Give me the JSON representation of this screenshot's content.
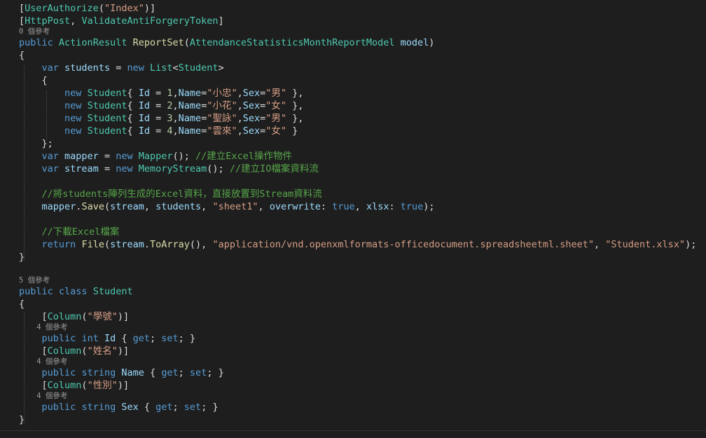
{
  "editor": {
    "colors": {
      "background": "#1e1e1e",
      "keyword": "#569cd6",
      "type": "#4ec9b0",
      "method": "#dcdcaa",
      "string": "#d69d85",
      "number": "#b5cea8",
      "comment": "#57a64a",
      "plain": "#dcdcdc",
      "variable": "#9cdcfe",
      "lens": "#999999"
    },
    "lines": [
      {
        "kind": "code",
        "tokens": [
          {
            "t": "[",
            "c": "plain"
          },
          {
            "t": "UserAuthorize",
            "c": "type"
          },
          {
            "t": "(",
            "c": "plain"
          },
          {
            "t": "\"Index\"",
            "c": "string"
          },
          {
            "t": ")]",
            "c": "plain"
          }
        ]
      },
      {
        "kind": "code",
        "tokens": [
          {
            "t": "[",
            "c": "plain"
          },
          {
            "t": "HttpPost",
            "c": "type"
          },
          {
            "t": ", ",
            "c": "plain"
          },
          {
            "t": "ValidateAntiForgeryToken",
            "c": "type"
          },
          {
            "t": "]",
            "c": "plain"
          }
        ]
      },
      {
        "kind": "lens",
        "text": "0 個參考"
      },
      {
        "kind": "code",
        "tokens": [
          {
            "t": "public",
            "c": "keyword"
          },
          {
            "t": " ",
            "c": "plain"
          },
          {
            "t": "ActionResult",
            "c": "type"
          },
          {
            "t": " ",
            "c": "plain"
          },
          {
            "t": "ReportSet",
            "c": "method"
          },
          {
            "t": "(",
            "c": "plain"
          },
          {
            "t": "AttendanceStatisticsMonthReportModel",
            "c": "type"
          },
          {
            "t": " ",
            "c": "plain"
          },
          {
            "t": "model",
            "c": "variable"
          },
          {
            "t": ")",
            "c": "plain"
          }
        ]
      },
      {
        "kind": "code",
        "tokens": [
          {
            "t": "{",
            "c": "plain"
          }
        ]
      },
      {
        "kind": "code",
        "tokens": [
          {
            "t": "    ",
            "c": "plain"
          },
          {
            "t": "var",
            "c": "keyword"
          },
          {
            "t": " ",
            "c": "plain"
          },
          {
            "t": "students",
            "c": "variable"
          },
          {
            "t": " = ",
            "c": "plain"
          },
          {
            "t": "new",
            "c": "keyword"
          },
          {
            "t": " ",
            "c": "plain"
          },
          {
            "t": "List",
            "c": "type"
          },
          {
            "t": "<",
            "c": "plain"
          },
          {
            "t": "Student",
            "c": "type"
          },
          {
            "t": ">",
            "c": "plain"
          }
        ]
      },
      {
        "kind": "code",
        "tokens": [
          {
            "t": "    {",
            "c": "plain"
          }
        ]
      },
      {
        "kind": "code",
        "tokens": [
          {
            "t": "        ",
            "c": "plain"
          },
          {
            "t": "new",
            "c": "keyword"
          },
          {
            "t": " ",
            "c": "plain"
          },
          {
            "t": "Student",
            "c": "type"
          },
          {
            "t": "{ ",
            "c": "plain"
          },
          {
            "t": "Id",
            "c": "variable"
          },
          {
            "t": " = ",
            "c": "plain"
          },
          {
            "t": "1",
            "c": "number"
          },
          {
            "t": ",",
            "c": "plain"
          },
          {
            "t": "Name",
            "c": "variable"
          },
          {
            "t": "=",
            "c": "plain"
          },
          {
            "t": "\"小忠\"",
            "c": "string"
          },
          {
            "t": ",",
            "c": "plain"
          },
          {
            "t": "Sex",
            "c": "variable"
          },
          {
            "t": "=",
            "c": "plain"
          },
          {
            "t": "\"男\"",
            "c": "string"
          },
          {
            "t": " },",
            "c": "plain"
          }
        ]
      },
      {
        "kind": "code",
        "tokens": [
          {
            "t": "        ",
            "c": "plain"
          },
          {
            "t": "new",
            "c": "keyword"
          },
          {
            "t": " ",
            "c": "plain"
          },
          {
            "t": "Student",
            "c": "type"
          },
          {
            "t": "{ ",
            "c": "plain"
          },
          {
            "t": "Id",
            "c": "variable"
          },
          {
            "t": " = ",
            "c": "plain"
          },
          {
            "t": "2",
            "c": "number"
          },
          {
            "t": ",",
            "c": "plain"
          },
          {
            "t": "Name",
            "c": "variable"
          },
          {
            "t": "=",
            "c": "plain"
          },
          {
            "t": "\"小花\"",
            "c": "string"
          },
          {
            "t": ",",
            "c": "plain"
          },
          {
            "t": "Sex",
            "c": "variable"
          },
          {
            "t": "=",
            "c": "plain"
          },
          {
            "t": "\"女\"",
            "c": "string"
          },
          {
            "t": " },",
            "c": "plain"
          }
        ]
      },
      {
        "kind": "code",
        "tokens": [
          {
            "t": "        ",
            "c": "plain"
          },
          {
            "t": "new",
            "c": "keyword"
          },
          {
            "t": " ",
            "c": "plain"
          },
          {
            "t": "Student",
            "c": "type"
          },
          {
            "t": "{ ",
            "c": "plain"
          },
          {
            "t": "Id",
            "c": "variable"
          },
          {
            "t": " = ",
            "c": "plain"
          },
          {
            "t": "3",
            "c": "number"
          },
          {
            "t": ",",
            "c": "plain"
          },
          {
            "t": "Name",
            "c": "variable"
          },
          {
            "t": "=",
            "c": "plain"
          },
          {
            "t": "\"聖詠\"",
            "c": "string"
          },
          {
            "t": ",",
            "c": "plain"
          },
          {
            "t": "Sex",
            "c": "variable"
          },
          {
            "t": "=",
            "c": "plain"
          },
          {
            "t": "\"男\"",
            "c": "string"
          },
          {
            "t": " },",
            "c": "plain"
          }
        ]
      },
      {
        "kind": "code",
        "tokens": [
          {
            "t": "        ",
            "c": "plain"
          },
          {
            "t": "new",
            "c": "keyword"
          },
          {
            "t": " ",
            "c": "plain"
          },
          {
            "t": "Student",
            "c": "type"
          },
          {
            "t": "{ ",
            "c": "plain"
          },
          {
            "t": "Id",
            "c": "variable"
          },
          {
            "t": " = ",
            "c": "plain"
          },
          {
            "t": "4",
            "c": "number"
          },
          {
            "t": ",",
            "c": "plain"
          },
          {
            "t": "Name",
            "c": "variable"
          },
          {
            "t": "=",
            "c": "plain"
          },
          {
            "t": "\"雲來\"",
            "c": "string"
          },
          {
            "t": ",",
            "c": "plain"
          },
          {
            "t": "Sex",
            "c": "variable"
          },
          {
            "t": "=",
            "c": "plain"
          },
          {
            "t": "\"女\"",
            "c": "string"
          },
          {
            "t": " }",
            "c": "plain"
          }
        ]
      },
      {
        "kind": "code",
        "tokens": [
          {
            "t": "    };",
            "c": "plain"
          }
        ]
      },
      {
        "kind": "code",
        "tokens": [
          {
            "t": "    ",
            "c": "plain"
          },
          {
            "t": "var",
            "c": "keyword"
          },
          {
            "t": " ",
            "c": "plain"
          },
          {
            "t": "mapper",
            "c": "variable"
          },
          {
            "t": " = ",
            "c": "plain"
          },
          {
            "t": "new",
            "c": "keyword"
          },
          {
            "t": " ",
            "c": "plain"
          },
          {
            "t": "Mapper",
            "c": "type"
          },
          {
            "t": "(); ",
            "c": "plain"
          },
          {
            "t": "//建立Excel操作物件",
            "c": "comment"
          }
        ]
      },
      {
        "kind": "code",
        "tokens": [
          {
            "t": "    ",
            "c": "plain"
          },
          {
            "t": "var",
            "c": "keyword"
          },
          {
            "t": " ",
            "c": "plain"
          },
          {
            "t": "stream",
            "c": "variable"
          },
          {
            "t": " = ",
            "c": "plain"
          },
          {
            "t": "new",
            "c": "keyword"
          },
          {
            "t": " ",
            "c": "plain"
          },
          {
            "t": "MemoryStream",
            "c": "type"
          },
          {
            "t": "(); ",
            "c": "plain"
          },
          {
            "t": "//建立IO檔案資料流",
            "c": "comment"
          }
        ]
      },
      {
        "kind": "code",
        "tokens": []
      },
      {
        "kind": "code",
        "tokens": [
          {
            "t": "    ",
            "c": "plain"
          },
          {
            "t": "//將students陣列生成的Excel資料，直接放置到Stream資料流",
            "c": "comment"
          }
        ]
      },
      {
        "kind": "code",
        "tokens": [
          {
            "t": "    ",
            "c": "plain"
          },
          {
            "t": "mapper",
            "c": "variable"
          },
          {
            "t": ".",
            "c": "plain"
          },
          {
            "t": "Save",
            "c": "method"
          },
          {
            "t": "(",
            "c": "plain"
          },
          {
            "t": "stream",
            "c": "variable"
          },
          {
            "t": ", ",
            "c": "plain"
          },
          {
            "t": "students",
            "c": "variable"
          },
          {
            "t": ", ",
            "c": "plain"
          },
          {
            "t": "\"sheet1\"",
            "c": "string"
          },
          {
            "t": ", ",
            "c": "plain"
          },
          {
            "t": "overwrite",
            "c": "variable"
          },
          {
            "t": ": ",
            "c": "plain"
          },
          {
            "t": "true",
            "c": "keyword"
          },
          {
            "t": ", ",
            "c": "plain"
          },
          {
            "t": "xlsx",
            "c": "variable"
          },
          {
            "t": ": ",
            "c": "plain"
          },
          {
            "t": "true",
            "c": "keyword"
          },
          {
            "t": ");",
            "c": "plain"
          }
        ]
      },
      {
        "kind": "code",
        "tokens": []
      },
      {
        "kind": "code",
        "tokens": [
          {
            "t": "    ",
            "c": "plain"
          },
          {
            "t": "//下載Excel檔案",
            "c": "comment"
          }
        ]
      },
      {
        "kind": "code",
        "tokens": [
          {
            "t": "    ",
            "c": "plain"
          },
          {
            "t": "return",
            "c": "keyword"
          },
          {
            "t": " ",
            "c": "plain"
          },
          {
            "t": "File",
            "c": "method"
          },
          {
            "t": "(",
            "c": "plain"
          },
          {
            "t": "stream",
            "c": "variable"
          },
          {
            "t": ".",
            "c": "plain"
          },
          {
            "t": "ToArray",
            "c": "method"
          },
          {
            "t": "(), ",
            "c": "plain"
          },
          {
            "t": "\"application/vnd.openxmlformats-officedocument.spreadsheetml.sheet\"",
            "c": "string"
          },
          {
            "t": ", ",
            "c": "plain"
          },
          {
            "t": "\"Student.xlsx\"",
            "c": "string"
          },
          {
            "t": ");",
            "c": "plain"
          }
        ]
      },
      {
        "kind": "code",
        "tokens": [
          {
            "t": "}",
            "c": "plain"
          }
        ]
      },
      {
        "kind": "code",
        "tokens": []
      },
      {
        "kind": "lens",
        "text": "5 個參考"
      },
      {
        "kind": "code",
        "tokens": [
          {
            "t": "public",
            "c": "keyword"
          },
          {
            "t": " ",
            "c": "plain"
          },
          {
            "t": "class",
            "c": "keyword"
          },
          {
            "t": " ",
            "c": "plain"
          },
          {
            "t": "Student",
            "c": "type"
          }
        ]
      },
      {
        "kind": "code",
        "tokens": [
          {
            "t": "{",
            "c": "plain"
          }
        ]
      },
      {
        "kind": "code",
        "tokens": [
          {
            "t": "    [",
            "c": "plain"
          },
          {
            "t": "Column",
            "c": "type"
          },
          {
            "t": "(",
            "c": "plain"
          },
          {
            "t": "\"學號\"",
            "c": "string"
          },
          {
            "t": ")]",
            "c": "plain"
          }
        ]
      },
      {
        "kind": "lens",
        "text": "    4 個參考"
      },
      {
        "kind": "code",
        "tokens": [
          {
            "t": "    ",
            "c": "plain"
          },
          {
            "t": "public",
            "c": "keyword"
          },
          {
            "t": " ",
            "c": "plain"
          },
          {
            "t": "int",
            "c": "keyword"
          },
          {
            "t": " ",
            "c": "plain"
          },
          {
            "t": "Id",
            "c": "variable"
          },
          {
            "t": " { ",
            "c": "plain"
          },
          {
            "t": "get",
            "c": "keyword"
          },
          {
            "t": "; ",
            "c": "plain"
          },
          {
            "t": "set",
            "c": "keyword"
          },
          {
            "t": "; }",
            "c": "plain"
          }
        ]
      },
      {
        "kind": "code",
        "tokens": [
          {
            "t": "    [",
            "c": "plain"
          },
          {
            "t": "Column",
            "c": "type"
          },
          {
            "t": "(",
            "c": "plain"
          },
          {
            "t": "\"姓名\"",
            "c": "string"
          },
          {
            "t": ")]",
            "c": "plain"
          }
        ]
      },
      {
        "kind": "lens",
        "text": "    4 個參考"
      },
      {
        "kind": "code",
        "tokens": [
          {
            "t": "    ",
            "c": "plain"
          },
          {
            "t": "public",
            "c": "keyword"
          },
          {
            "t": " ",
            "c": "plain"
          },
          {
            "t": "string",
            "c": "keyword"
          },
          {
            "t": " ",
            "c": "plain"
          },
          {
            "t": "Name",
            "c": "variable"
          },
          {
            "t": " { ",
            "c": "plain"
          },
          {
            "t": "get",
            "c": "keyword"
          },
          {
            "t": "; ",
            "c": "plain"
          },
          {
            "t": "set",
            "c": "keyword"
          },
          {
            "t": "; }",
            "c": "plain"
          }
        ]
      },
      {
        "kind": "code",
        "tokens": [
          {
            "t": "    [",
            "c": "plain"
          },
          {
            "t": "Column",
            "c": "type"
          },
          {
            "t": "(",
            "c": "plain"
          },
          {
            "t": "\"性別\"",
            "c": "string"
          },
          {
            "t": ")]",
            "c": "plain"
          }
        ]
      },
      {
        "kind": "lens",
        "text": "    4 個參考"
      },
      {
        "kind": "code",
        "tokens": [
          {
            "t": "    ",
            "c": "plain"
          },
          {
            "t": "public",
            "c": "keyword"
          },
          {
            "t": " ",
            "c": "plain"
          },
          {
            "t": "string",
            "c": "keyword"
          },
          {
            "t": " ",
            "c": "plain"
          },
          {
            "t": "Sex",
            "c": "variable"
          },
          {
            "t": " { ",
            "c": "plain"
          },
          {
            "t": "get",
            "c": "keyword"
          },
          {
            "t": "; ",
            "c": "plain"
          },
          {
            "t": "set",
            "c": "keyword"
          },
          {
            "t": "; }",
            "c": "plain"
          }
        ]
      },
      {
        "kind": "code",
        "tokens": [
          {
            "t": "}",
            "c": "plain"
          }
        ]
      }
    ]
  }
}
